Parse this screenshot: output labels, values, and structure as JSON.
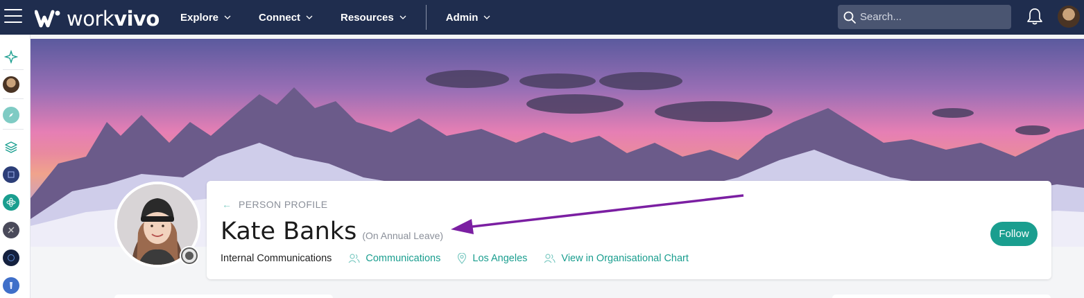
{
  "app": {
    "brand": "workvivo",
    "brand_light": "work",
    "brand_bold": "vivo"
  },
  "nav": {
    "items": [
      {
        "label": "Explore"
      },
      {
        "label": "Connect"
      },
      {
        "label": "Resources"
      },
      {
        "label": "Admin"
      }
    ]
  },
  "search": {
    "placeholder": "Search..."
  },
  "profile": {
    "section_label": "PERSON PROFILE",
    "name": "Kate Banks",
    "status": "(On Annual Leave)",
    "job_title": "Internal Communications",
    "team": "Communications",
    "location": "Los Angeles",
    "org_chart_link": "View in Organisational Chart",
    "follow_label": "Follow"
  },
  "colors": {
    "nav_bg": "#1f2d4e",
    "accent": "#1a9e8f",
    "annotation_arrow": "#7b1fa2"
  },
  "icons": {
    "rail": [
      "sparkle-icon",
      "user-avatar",
      "compass-icon",
      "layers-icon",
      "space-icon-1",
      "atom-icon",
      "space-icon-2",
      "space-icon-3",
      "space-icon-4"
    ]
  }
}
